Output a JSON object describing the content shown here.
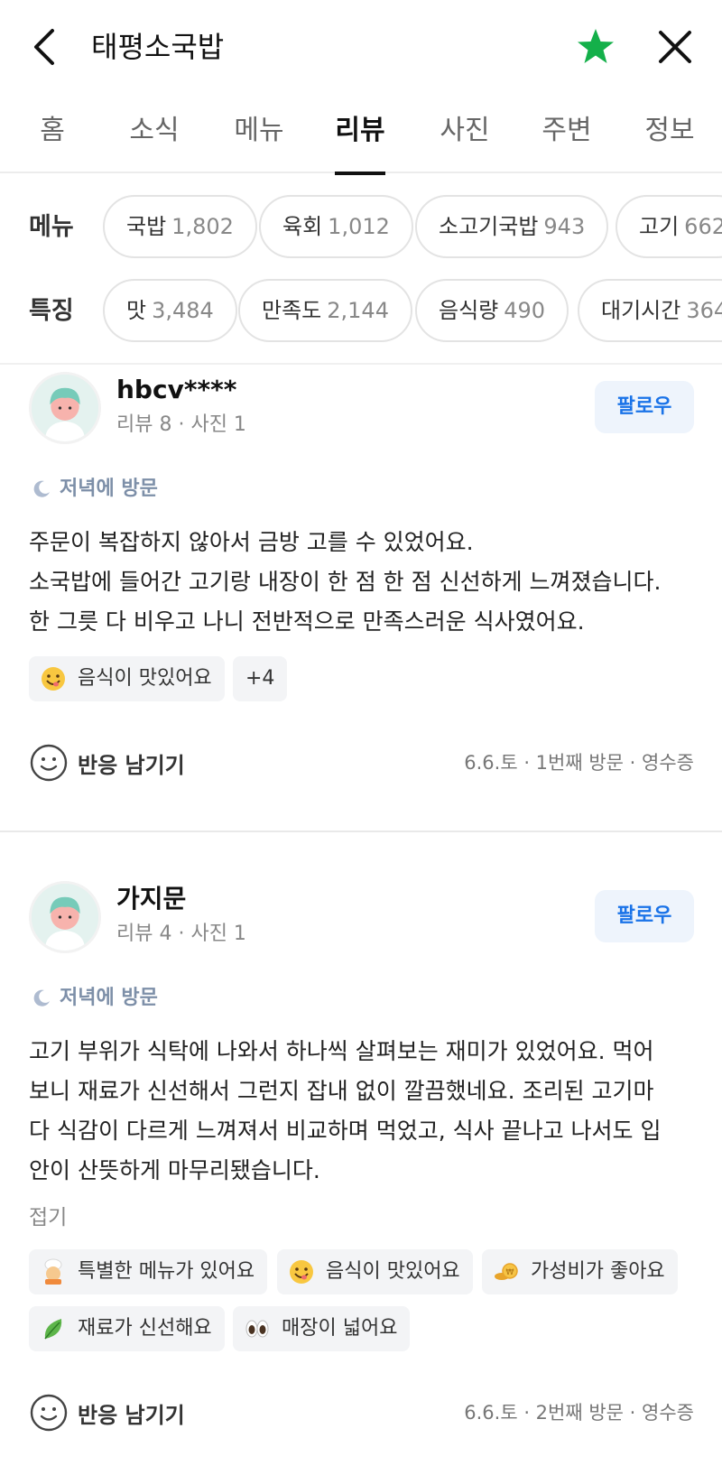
{
  "header": {
    "title": "태평소국밥",
    "star_color": "#14b04a"
  },
  "tabs": [
    {
      "label": "홈",
      "active": false
    },
    {
      "label": "소식",
      "active": false
    },
    {
      "label": "메뉴",
      "active": false
    },
    {
      "label": "리뷰",
      "active": true
    },
    {
      "label": "사진",
      "active": false
    },
    {
      "label": "주변",
      "active": false
    },
    {
      "label": "정보",
      "active": false
    }
  ],
  "filters": {
    "menu": {
      "label": "메뉴",
      "chips": [
        {
          "name": "국밥",
          "count": "1,802"
        },
        {
          "name": "육회",
          "count": "1,012"
        },
        {
          "name": "소고기국밥",
          "count": "943"
        },
        {
          "name": "고기",
          "count": "662"
        }
      ]
    },
    "feature": {
      "label": "특징",
      "chips": [
        {
          "name": "맛",
          "count": "3,484"
        },
        {
          "name": "만족도",
          "count": "2,144"
        },
        {
          "name": "음식량",
          "count": "490"
        },
        {
          "name": "대기시간",
          "count": "364"
        }
      ]
    }
  },
  "reviews": [
    {
      "username": "hbcv****",
      "stats": "리뷰 8 · 사진 1",
      "follow_label": "팔로우",
      "visit_time": "저녁에 방문",
      "text_lines": [
        "주문이 복잡하지 않아서 금방 고를 수 있었어요.",
        "소국밥에 들어간 고기랑 내장이 한 점 한 점 신선하게 느껴졌습니다.",
        "한 그릇 다 비우고 나니 전반적으로 만족스러운 식사였어요."
      ],
      "tags": [
        {
          "label": "음식이 맛있어요",
          "icon": "yum-face-icon"
        }
      ],
      "more_tags": "+4",
      "react_label": "반응 남기기",
      "meta": "6.6.토 · 1번째 방문 · 영수증"
    },
    {
      "username": "가지문",
      "stats": "리뷰 4 · 사진 1",
      "follow_label": "팔로우",
      "visit_time": "저녁에 방문",
      "text_lines": [
        "고기 부위가 식탁에 나와서 하나씩 살펴보는 재미가 있었어요. 먹어",
        "보니 재료가 신선해서 그런지 잡내 없이 깔끔했네요. 조리된 고기마",
        "다 식감이 다르게 느껴져서 비교하며 먹었고, 식사 끝나고 나서도 입",
        "안이 산뜻하게 마무리됐습니다."
      ],
      "fold_label": "접기",
      "tags": [
        {
          "label": "특별한 메뉴가 있어요",
          "icon": "chef-icon"
        },
        {
          "label": "음식이 맛있어요",
          "icon": "yum-face-icon"
        },
        {
          "label": "가성비가 좋아요",
          "icon": "coin-icon"
        },
        {
          "label": "재료가 신선해요",
          "icon": "leaf-icon"
        },
        {
          "label": "매장이 넓어요",
          "icon": "eyes-icon"
        }
      ],
      "react_label": "반응 남기기",
      "meta": "6.6.토 · 2번째 방문 · 영수증"
    }
  ]
}
